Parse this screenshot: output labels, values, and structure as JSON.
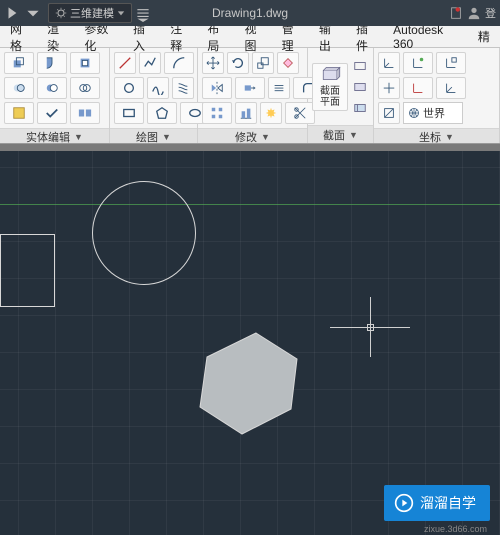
{
  "title": "Drawing1.dwg",
  "workspace": "三维建模",
  "menus": [
    "网格",
    "渲染",
    "参数化",
    "插入",
    "注释",
    "布局",
    "视图",
    "管理",
    "输出",
    "插件",
    "Autodesk 360",
    "精"
  ],
  "panels": {
    "p1": "实体编辑",
    "p2": "绘图",
    "p3": "修改",
    "p4": "截面",
    "p5": "坐标"
  },
  "big_icons": {
    "section": "截面\n平面"
  },
  "coord_label": "世界",
  "user_label": "登",
  "watermark": {
    "main": "溜溜自学",
    "sub": "zixue.3d66.com"
  }
}
